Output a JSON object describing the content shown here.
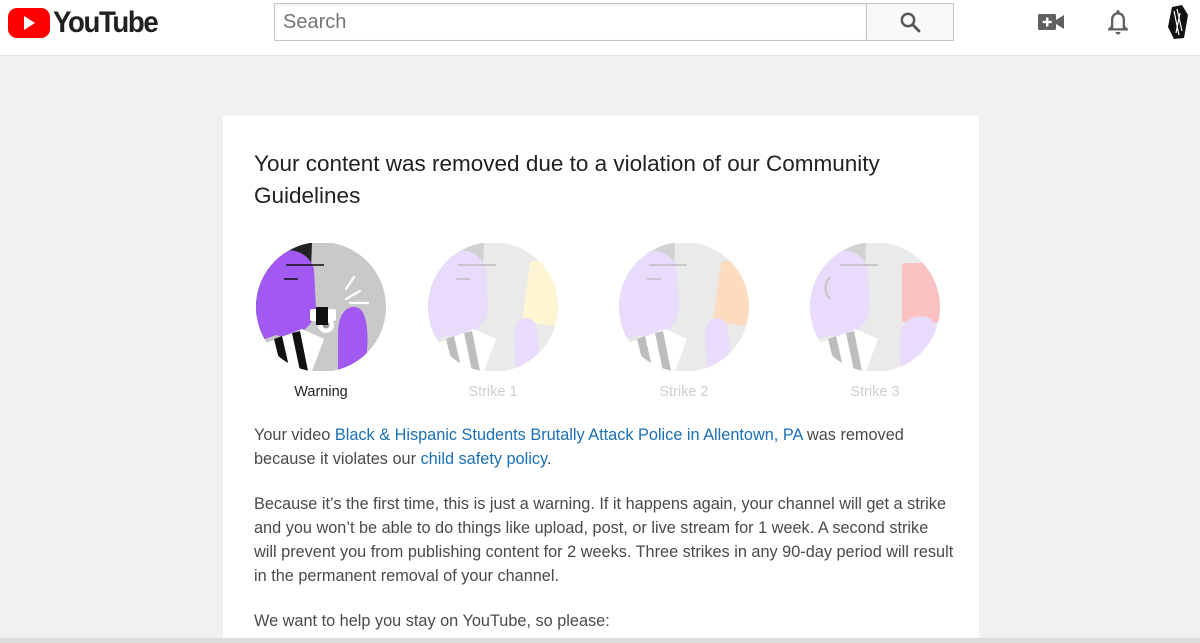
{
  "header": {
    "logo_text": "YouTube",
    "search_placeholder": "Search",
    "icons": [
      "youtube-logo-icon",
      "search-icon",
      "create-video-icon",
      "notifications-bell-icon",
      "account-avatar"
    ]
  },
  "notice": {
    "title": "Your content was removed due to a violation of our Community Guidelines",
    "steps": [
      {
        "label": "Warning",
        "state": "active"
      },
      {
        "label": "Strike 1",
        "state": "inactive"
      },
      {
        "label": "Strike 2",
        "state": "inactive"
      },
      {
        "label": "Strike 3",
        "state": "inactive"
      }
    ],
    "p1": {
      "prefix": "Your video ",
      "video_link": "Black & Hispanic Students Brutally Attack Police in Allentown, PA",
      "middle": " was removed because it violates our ",
      "policy_link": "child safety policy",
      "suffix": "."
    },
    "p2": "Because it’s the first time, this is just a warning. If it happens again, your channel will get a strike and you won’t be able to do things like upload, post, or live stream for 1 week. A second strike will prevent you from publishing content for 2 weeks. Three strikes in any 90-day period will result in the permanent removal of your channel.",
    "p3": "We want to help you stay on YouTube, so please:"
  },
  "colors": {
    "brand_red": "#ff0000",
    "link_blue": "#1a6fb5",
    "illustration_purple": "#a259f2",
    "card_yellow": "#fde68a",
    "card_orange": "#f9a35a",
    "card_red": "#f26060"
  }
}
